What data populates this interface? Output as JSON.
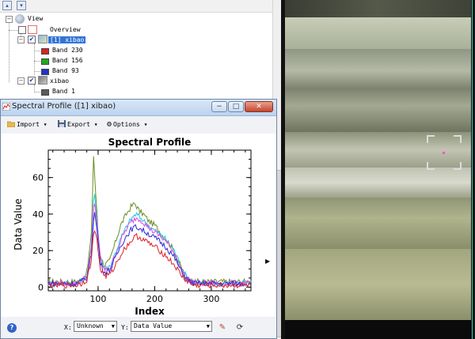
{
  "layer_manager": {
    "toolbar": {
      "up_arrow": "▴",
      "down_arrow": "▾"
    },
    "tree": {
      "root_label": "View",
      "items": [
        {
          "label": "Overview",
          "checked": false
        },
        {
          "label": "[1] xibao",
          "checked": true,
          "selected": true
        },
        {
          "label": "Band 230",
          "swatch_color": "#d62424"
        },
        {
          "label": "Band 156",
          "swatch_color": "#1fa81f"
        },
        {
          "label": "Band 93",
          "swatch_color": "#2233cc"
        },
        {
          "label": "xibao",
          "checked": true
        },
        {
          "label": "Band 1",
          "swatch_color": "#5a5a5a"
        }
      ]
    }
  },
  "spectral_window": {
    "title": "Spectral Profile ([1] xibao)",
    "window_buttons": {
      "minimize": "−",
      "maximize": "□",
      "close": "✕"
    },
    "menu": [
      {
        "label": "Import",
        "icon": "folder-icon"
      },
      {
        "label": "Export",
        "icon": "floppy-disk-icon"
      },
      {
        "label": "Options",
        "icon": "gear-icon"
      }
    ],
    "bottom": {
      "help": "?",
      "x_label": "X:",
      "x_value": "Unknown",
      "y_label": "Y:",
      "y_value": "Data Value"
    }
  },
  "chart_data": {
    "type": "line",
    "title": "Spectral Profile",
    "xlabel": "Index",
    "ylabel": "Data Value",
    "xlim": [
      12,
      370
    ],
    "ylim": [
      -2,
      75
    ],
    "x_ticks": [
      100,
      200,
      300
    ],
    "y_ticks": [
      0,
      20,
      40,
      60
    ],
    "grid": false,
    "series": [
      {
        "color": "#6b8e23",
        "points": [
          [
            12,
            3
          ],
          [
            60,
            3
          ],
          [
            70,
            4
          ],
          [
            80,
            8
          ],
          [
            88,
            28
          ],
          [
            92,
            72
          ],
          [
            96,
            50
          ],
          [
            102,
            20
          ],
          [
            110,
            12
          ],
          [
            120,
            14
          ],
          [
            130,
            24
          ],
          [
            140,
            34
          ],
          [
            150,
            40
          ],
          [
            158,
            44
          ],
          [
            165,
            46
          ],
          [
            172,
            42
          ],
          [
            180,
            40
          ],
          [
            190,
            36
          ],
          [
            200,
            34
          ],
          [
            215,
            28
          ],
          [
            230,
            22
          ],
          [
            245,
            12
          ],
          [
            255,
            6
          ],
          [
            265,
            3
          ],
          [
            280,
            3
          ],
          [
            370,
            3
          ]
        ]
      },
      {
        "color": "#1ec8e8",
        "points": [
          [
            12,
            2
          ],
          [
            60,
            2
          ],
          [
            70,
            3
          ],
          [
            80,
            6
          ],
          [
            88,
            22
          ],
          [
            93,
            53
          ],
          [
            98,
            38
          ],
          [
            104,
            16
          ],
          [
            112,
            10
          ],
          [
            122,
            12
          ],
          [
            132,
            20
          ],
          [
            142,
            28
          ],
          [
            152,
            34
          ],
          [
            160,
            38
          ],
          [
            167,
            40
          ],
          [
            175,
            38
          ],
          [
            185,
            35
          ],
          [
            195,
            32
          ],
          [
            205,
            30
          ],
          [
            220,
            26
          ],
          [
            235,
            20
          ],
          [
            248,
            10
          ],
          [
            258,
            5
          ],
          [
            268,
            3
          ],
          [
            280,
            2
          ],
          [
            370,
            2
          ]
        ]
      },
      {
        "color": "#dc4ce0",
        "points": [
          [
            12,
            2
          ],
          [
            60,
            2
          ],
          [
            70,
            3
          ],
          [
            80,
            6
          ],
          [
            88,
            20
          ],
          [
            93,
            49
          ],
          [
            98,
            35
          ],
          [
            104,
            15
          ],
          [
            112,
            9
          ],
          [
            122,
            11
          ],
          [
            132,
            19
          ],
          [
            142,
            27
          ],
          [
            152,
            33
          ],
          [
            160,
            36
          ],
          [
            167,
            38
          ],
          [
            175,
            37
          ],
          [
            185,
            34
          ],
          [
            195,
            31
          ],
          [
            205,
            29
          ],
          [
            220,
            25
          ],
          [
            235,
            19
          ],
          [
            248,
            9
          ],
          [
            258,
            4
          ],
          [
            268,
            3
          ],
          [
            280,
            2
          ],
          [
            370,
            2
          ]
        ]
      },
      {
        "color": "#2a2ad8",
        "points": [
          [
            12,
            2
          ],
          [
            60,
            2
          ],
          [
            70,
            3
          ],
          [
            80,
            5
          ],
          [
            88,
            18
          ],
          [
            93,
            43
          ],
          [
            98,
            31
          ],
          [
            104,
            13
          ],
          [
            112,
            8
          ],
          [
            122,
            10
          ],
          [
            132,
            17
          ],
          [
            142,
            24
          ],
          [
            152,
            29
          ],
          [
            160,
            32
          ],
          [
            167,
            33
          ],
          [
            175,
            32
          ],
          [
            185,
            30
          ],
          [
            195,
            28
          ],
          [
            205,
            26
          ],
          [
            220,
            22
          ],
          [
            235,
            16
          ],
          [
            248,
            8
          ],
          [
            258,
            4
          ],
          [
            268,
            2
          ],
          [
            280,
            2
          ],
          [
            370,
            2
          ]
        ]
      },
      {
        "color": "#e02020",
        "points": [
          [
            12,
            1
          ],
          [
            60,
            1
          ],
          [
            70,
            2
          ],
          [
            80,
            4
          ],
          [
            88,
            14
          ],
          [
            93,
            34
          ],
          [
            98,
            25
          ],
          [
            104,
            10
          ],
          [
            112,
            6
          ],
          [
            122,
            7
          ],
          [
            132,
            13
          ],
          [
            142,
            19
          ],
          [
            152,
            23
          ],
          [
            160,
            26
          ],
          [
            167,
            28
          ],
          [
            175,
            27
          ],
          [
            185,
            25
          ],
          [
            195,
            23
          ],
          [
            205,
            21
          ],
          [
            220,
            17
          ],
          [
            235,
            12
          ],
          [
            248,
            6
          ],
          [
            258,
            3
          ],
          [
            268,
            1
          ],
          [
            280,
            1
          ],
          [
            370,
            1
          ]
        ]
      }
    ]
  }
}
